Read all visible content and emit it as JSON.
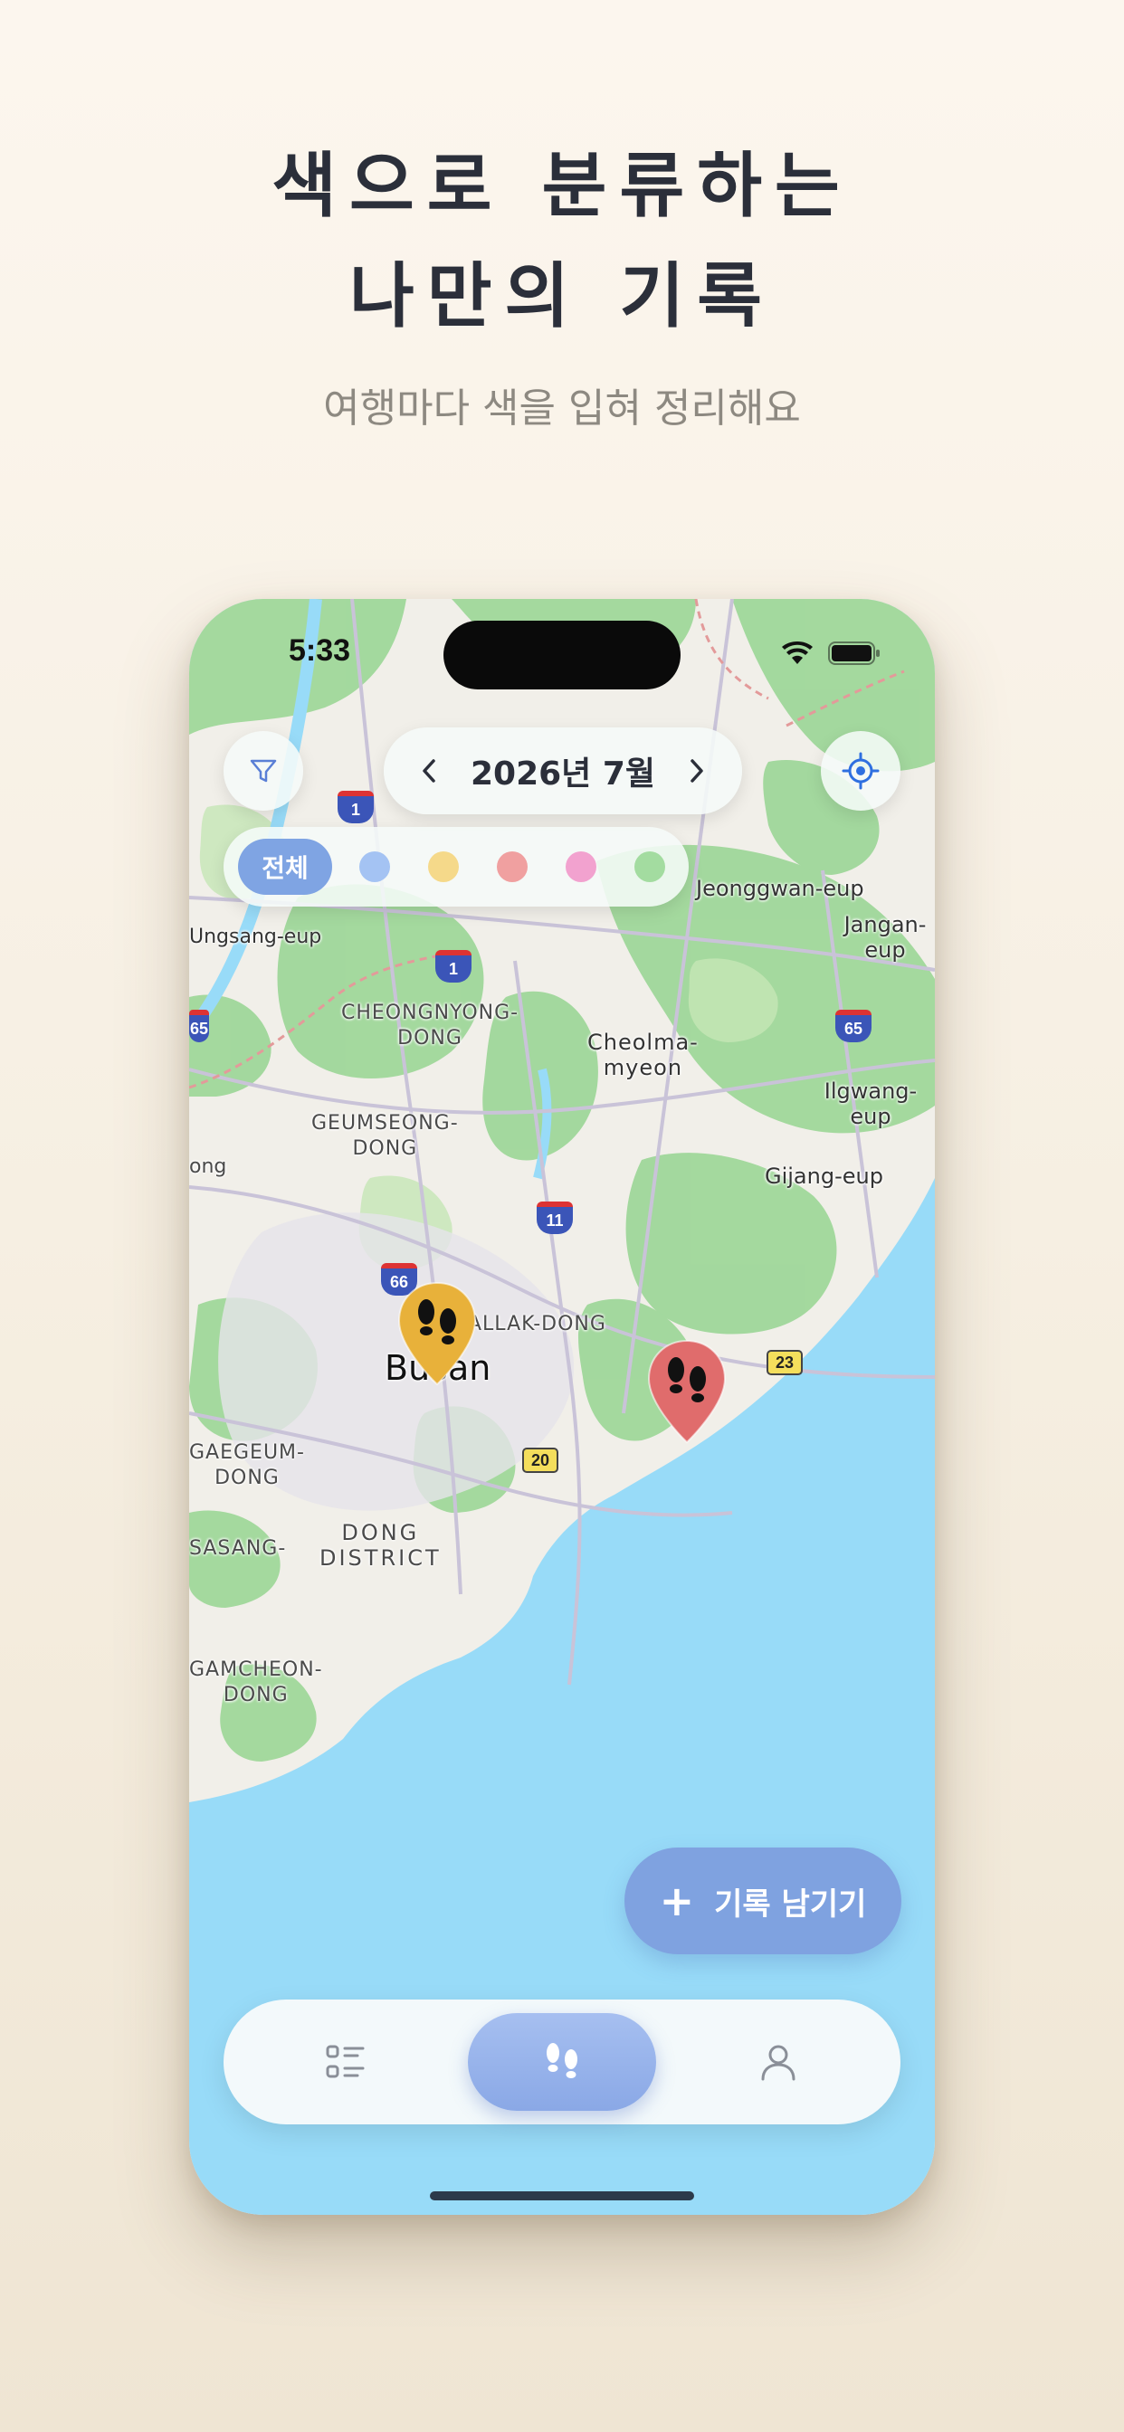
{
  "headline": {
    "line1": "색으로 분류하는",
    "line2": "나만의 기록"
  },
  "subheadline": "여행마다 색을 입혀 정리해요",
  "status_bar": {
    "time": "5:33"
  },
  "header": {
    "month_label": "2026년 7월",
    "filter_icon": "filter-icon",
    "locate_icon": "crosshair-icon"
  },
  "color_filter": {
    "all_label": "전체",
    "colors": [
      "#a4c3f3",
      "#f5d98a",
      "#f0a0a0",
      "#f2a2cf",
      "#a3dca0"
    ]
  },
  "map": {
    "labels": {
      "cheongnyong": "CHEONGNYONG-\nDONG",
      "geumseong": "GEUMSEONG-\nDONG",
      "cheolma": "Cheolma-\nmyeon",
      "jangan": "Jangan-eup",
      "gijang": "Gijang-eup",
      "ilgwang": "Ilgwang-eup",
      "yeonggwan": "Jeonggwan-eup",
      "ungsang": "Ungsang-eup",
      "allak": "ALLAK-DONG",
      "busan": "Busan",
      "dong": "DONG\nDISTRICT",
      "gamcheon": "GAMCHEON-\nDONG",
      "gaegeum": "GAEGEUM-\nDONG",
      "sasang": "SASANG-",
      "bukgu": "ong"
    },
    "shields": {
      "r1a": "1",
      "r1b": "1",
      "r65a": "65",
      "r65b": "65",
      "r66": "66",
      "r11": "11",
      "r20": "20",
      "r23": "23"
    },
    "markers": [
      {
        "name": "yellow-marker",
        "color": "#e8b13a"
      },
      {
        "name": "red-marker",
        "color": "#e06c6c"
      }
    ]
  },
  "fab": {
    "label": "기록 남기기"
  },
  "tabbar": {
    "tabs": [
      {
        "name": "list",
        "icon": "list-icon"
      },
      {
        "name": "map",
        "icon": "footprints-icon"
      },
      {
        "name": "profile",
        "icon": "person-icon"
      }
    ],
    "active": "map"
  },
  "colors": {
    "accent": "#7fa2e0",
    "background": "#f6efe2",
    "text": "#2b2f3a"
  }
}
